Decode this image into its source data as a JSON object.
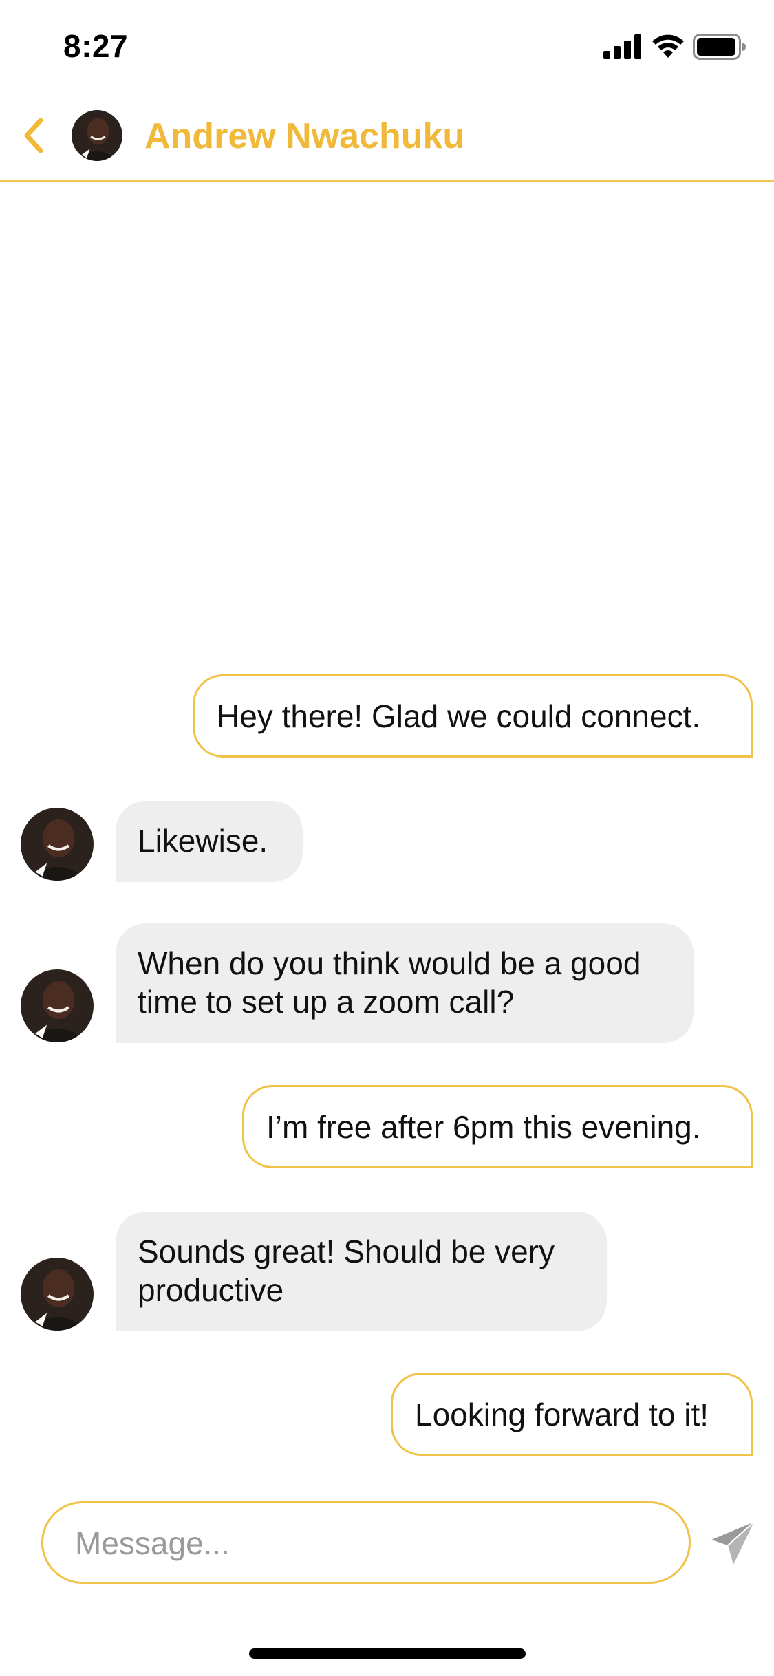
{
  "status_bar": {
    "time": "8:27",
    "icons": [
      "cellular-signal-icon",
      "wifi-icon",
      "battery-icon"
    ]
  },
  "header": {
    "back_icon": "chevron-left-icon",
    "contact_name": "Andrew Nwachuku"
  },
  "messages": [
    {
      "sender": "me",
      "text": "Hey there! Glad we could connect."
    },
    {
      "sender": "contact",
      "text": "Likewise."
    },
    {
      "sender": "contact",
      "text": "When do you think would be a good time to set up a zoom call?"
    },
    {
      "sender": "me",
      "text": "I’m free after 6pm this evening."
    },
    {
      "sender": "contact",
      "text": "Sounds great! Should be very productive"
    },
    {
      "sender": "me",
      "text": "Looking forward to it!"
    }
  ],
  "composer": {
    "placeholder": "Message...",
    "value": "",
    "send_icon": "paper-plane-icon"
  },
  "colors": {
    "accent": "#f0b93a",
    "sent_bubble_border": "#f1c24a",
    "received_bubble_bg": "#eeeeee",
    "placeholder": "#9a9a9a"
  }
}
